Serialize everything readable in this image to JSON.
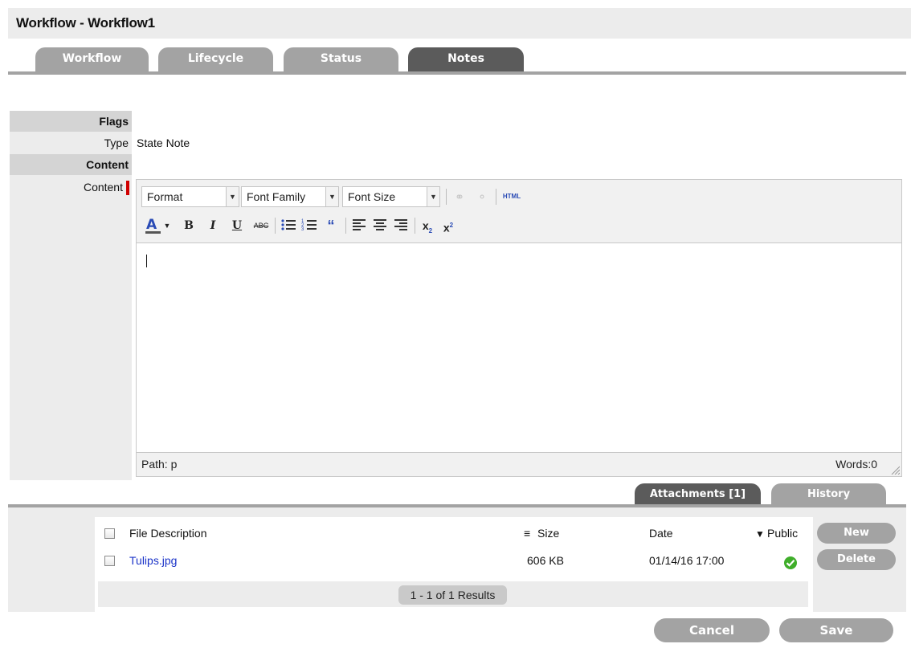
{
  "window": {
    "title": "Workflow - Workflow1"
  },
  "tabs": [
    {
      "label": "Workflow",
      "active": false
    },
    {
      "label": "Lifecycle",
      "active": false
    },
    {
      "label": "Status",
      "active": false
    },
    {
      "label": "Notes",
      "active": true
    }
  ],
  "form": {
    "flags_heading": "Flags",
    "type_label": "Type",
    "type_value": "State Note",
    "content_heading": "Content",
    "content_label": "Content"
  },
  "editor": {
    "format_label": "Format",
    "font_family_label": "Font Family",
    "font_size_label": "Font Size",
    "html_label": "HTML",
    "status_path": "Path: p",
    "status_words": "Words:0"
  },
  "sub_tabs": [
    {
      "label": "Attachments [1]",
      "active": true
    },
    {
      "label": "History",
      "active": false
    }
  ],
  "attachments": {
    "columns": [
      "File Description",
      "Size",
      "Date",
      "Public"
    ],
    "rows": [
      {
        "file": "Tulips.jpg",
        "size": "606 KB",
        "date": "01/14/16 17:00",
        "public": true
      }
    ],
    "results_text": "1 - 1 of 1 Results",
    "new_label": "New",
    "delete_label": "Delete"
  },
  "actions": {
    "cancel_label": "Cancel",
    "save_label": "Save"
  },
  "colors": {
    "tab_inactive": "#a3a3a3",
    "tab_active": "#5b5b5b",
    "link": "#1a33c8",
    "required": "#d00000",
    "public_check": "#3fae2a"
  }
}
